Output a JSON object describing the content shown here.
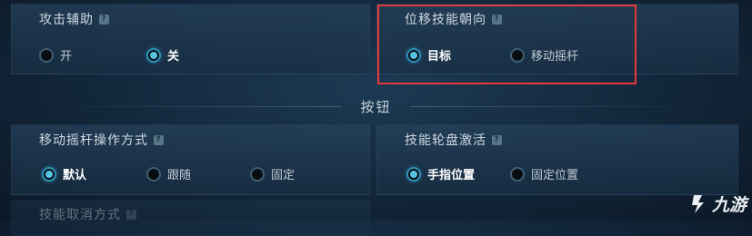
{
  "attack_assist": {
    "title": "攻击辅助",
    "options": [
      {
        "label": "开",
        "selected": false
      },
      {
        "label": "关",
        "selected": true
      }
    ]
  },
  "skill_direction": {
    "title": "位移技能朝向",
    "options": [
      {
        "label": "目标",
        "selected": true
      },
      {
        "label": "移动摇杆",
        "selected": false
      }
    ]
  },
  "section": {
    "title": "按钮"
  },
  "joystick_mode": {
    "title": "移动摇杆操作方式",
    "options": [
      {
        "label": "默认",
        "selected": true
      },
      {
        "label": "跟随",
        "selected": false
      },
      {
        "label": "固定",
        "selected": false
      }
    ]
  },
  "skill_wheel": {
    "title": "技能轮盘激活",
    "options": [
      {
        "label": "手指位置",
        "selected": true
      },
      {
        "label": "固定位置",
        "selected": false
      }
    ]
  },
  "cancel_mode": {
    "title": "技能取消方式"
  },
  "watermark": {
    "text": "九游"
  },
  "colors": {
    "highlight": "#e23a3a",
    "radio_selected": "#56c3e3"
  }
}
